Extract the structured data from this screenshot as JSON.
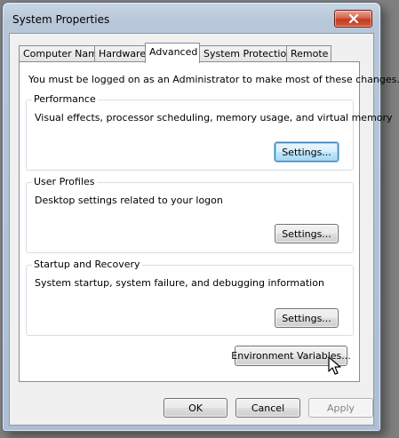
{
  "window": {
    "title": "System Properties"
  },
  "tabs": [
    {
      "label": "Computer Name",
      "active": false
    },
    {
      "label": "Hardware",
      "active": false
    },
    {
      "label": "Advanced",
      "active": true
    },
    {
      "label": "System Protection",
      "active": false
    },
    {
      "label": "Remote",
      "active": false
    }
  ],
  "advanced": {
    "intro": "You must be logged on as an Administrator to make most of these changes.",
    "performance": {
      "label": "Performance",
      "description": "Visual effects, processor scheduling, memory usage, and virtual memory",
      "button": "Settings..."
    },
    "user_profiles": {
      "label": "User Profiles",
      "description": "Desktop settings related to your logon",
      "button": "Settings..."
    },
    "startup_recovery": {
      "label": "Startup and Recovery",
      "description": "System startup, system failure, and debugging information",
      "button": "Settings..."
    },
    "env_button": "Environment Variables..."
  },
  "footer": {
    "ok": "OK",
    "cancel": "Cancel",
    "apply": "Apply"
  },
  "icons": {
    "close": "close-x",
    "cursor": "arrow-pointer"
  },
  "colors": {
    "close_red": "#c23b1f",
    "focus_blue": "#3c7fb1",
    "frame_blue": "#b7c6d8"
  }
}
